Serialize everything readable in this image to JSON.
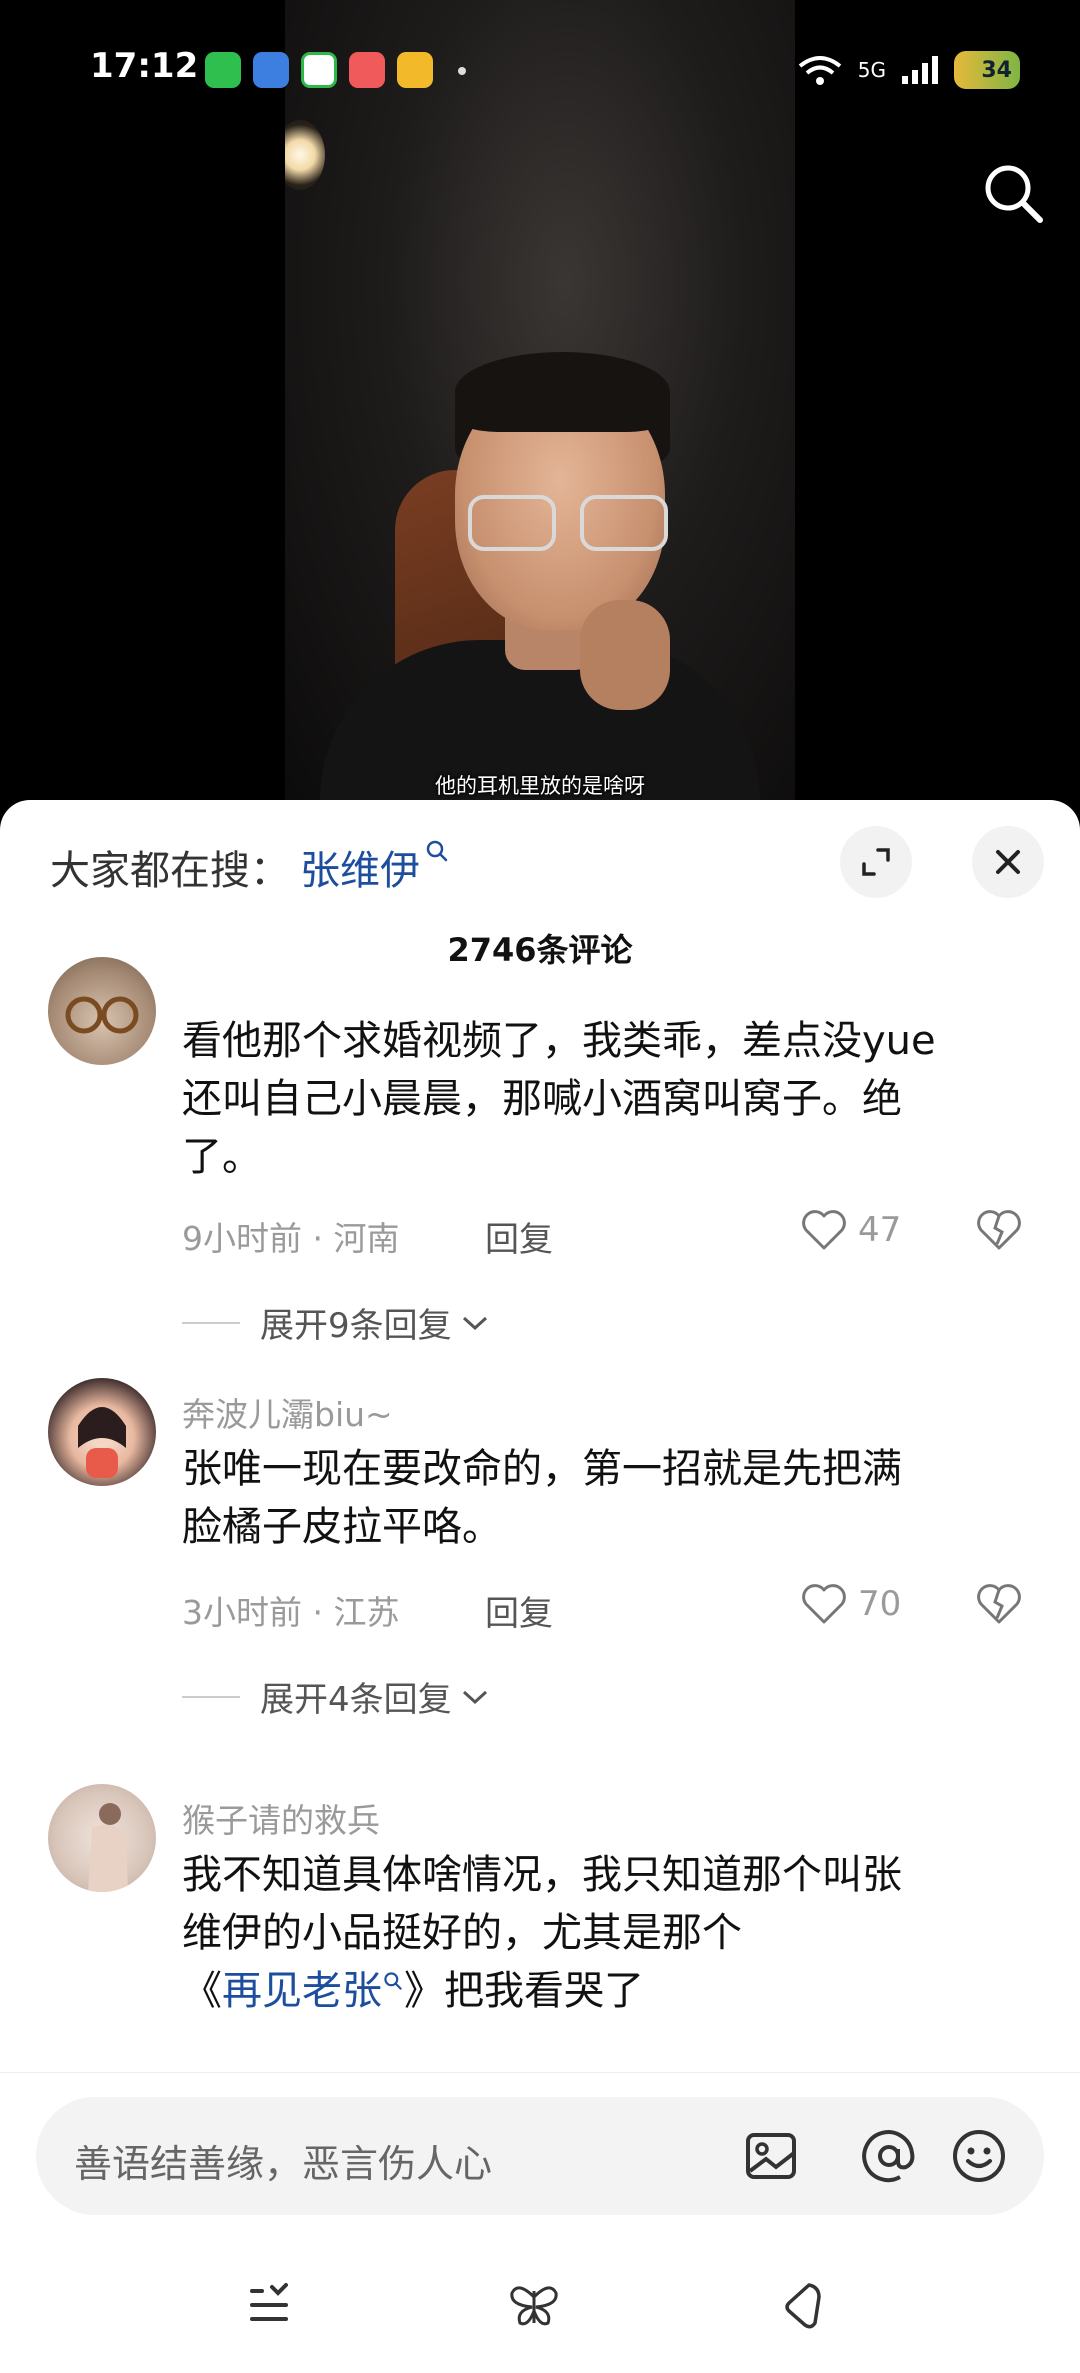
{
  "status_bar": {
    "time": "17:12",
    "network": "5G",
    "battery": "34",
    "app_icons": [
      "wechat-icon",
      "weather-icon",
      "security-icon",
      "weibo-icon",
      "rewards-icon"
    ]
  },
  "video": {
    "subtitle": "他的耳机里放的是啥呀"
  },
  "panel": {
    "hot_search_label": "大家都在搜：",
    "hot_search_term": "张维伊",
    "comment_count": "2746条评论"
  },
  "comments": [
    {
      "username": "",
      "text_lines": [
        "看他那个求婚视频了，我类乖，差点没yue",
        "还叫自己小晨晨，那喊小酒窝叫窝子。绝",
        "了。"
      ],
      "time_location": "9小时前 · 河南",
      "reply_label": "回复",
      "likes": "47",
      "expand_label": "展开9条回复"
    },
    {
      "username": "奔波儿灞biu~",
      "text_lines": [
        "张唯一现在要改命的，第一招就是先把满",
        "脸橘子皮拉平咯。"
      ],
      "time_location": "3小时前 · 江苏",
      "reply_label": "回复",
      "likes": "70",
      "expand_label": "展开4条回复"
    },
    {
      "username": "猴子请的救兵",
      "text_lines": [
        "我不知道具体啥情况，我只知道那个叫张",
        "维伊的小品挺好的，尤其是那个"
      ],
      "line3_prefix": "《",
      "line3_link": "再见老张",
      "line3_suffix": "》把我看哭了"
    }
  ],
  "input": {
    "placeholder": "善语结善缘，恶言伤人心"
  },
  "colors": {
    "link": "#1d4e9e",
    "muted": "#9a9a9a"
  }
}
